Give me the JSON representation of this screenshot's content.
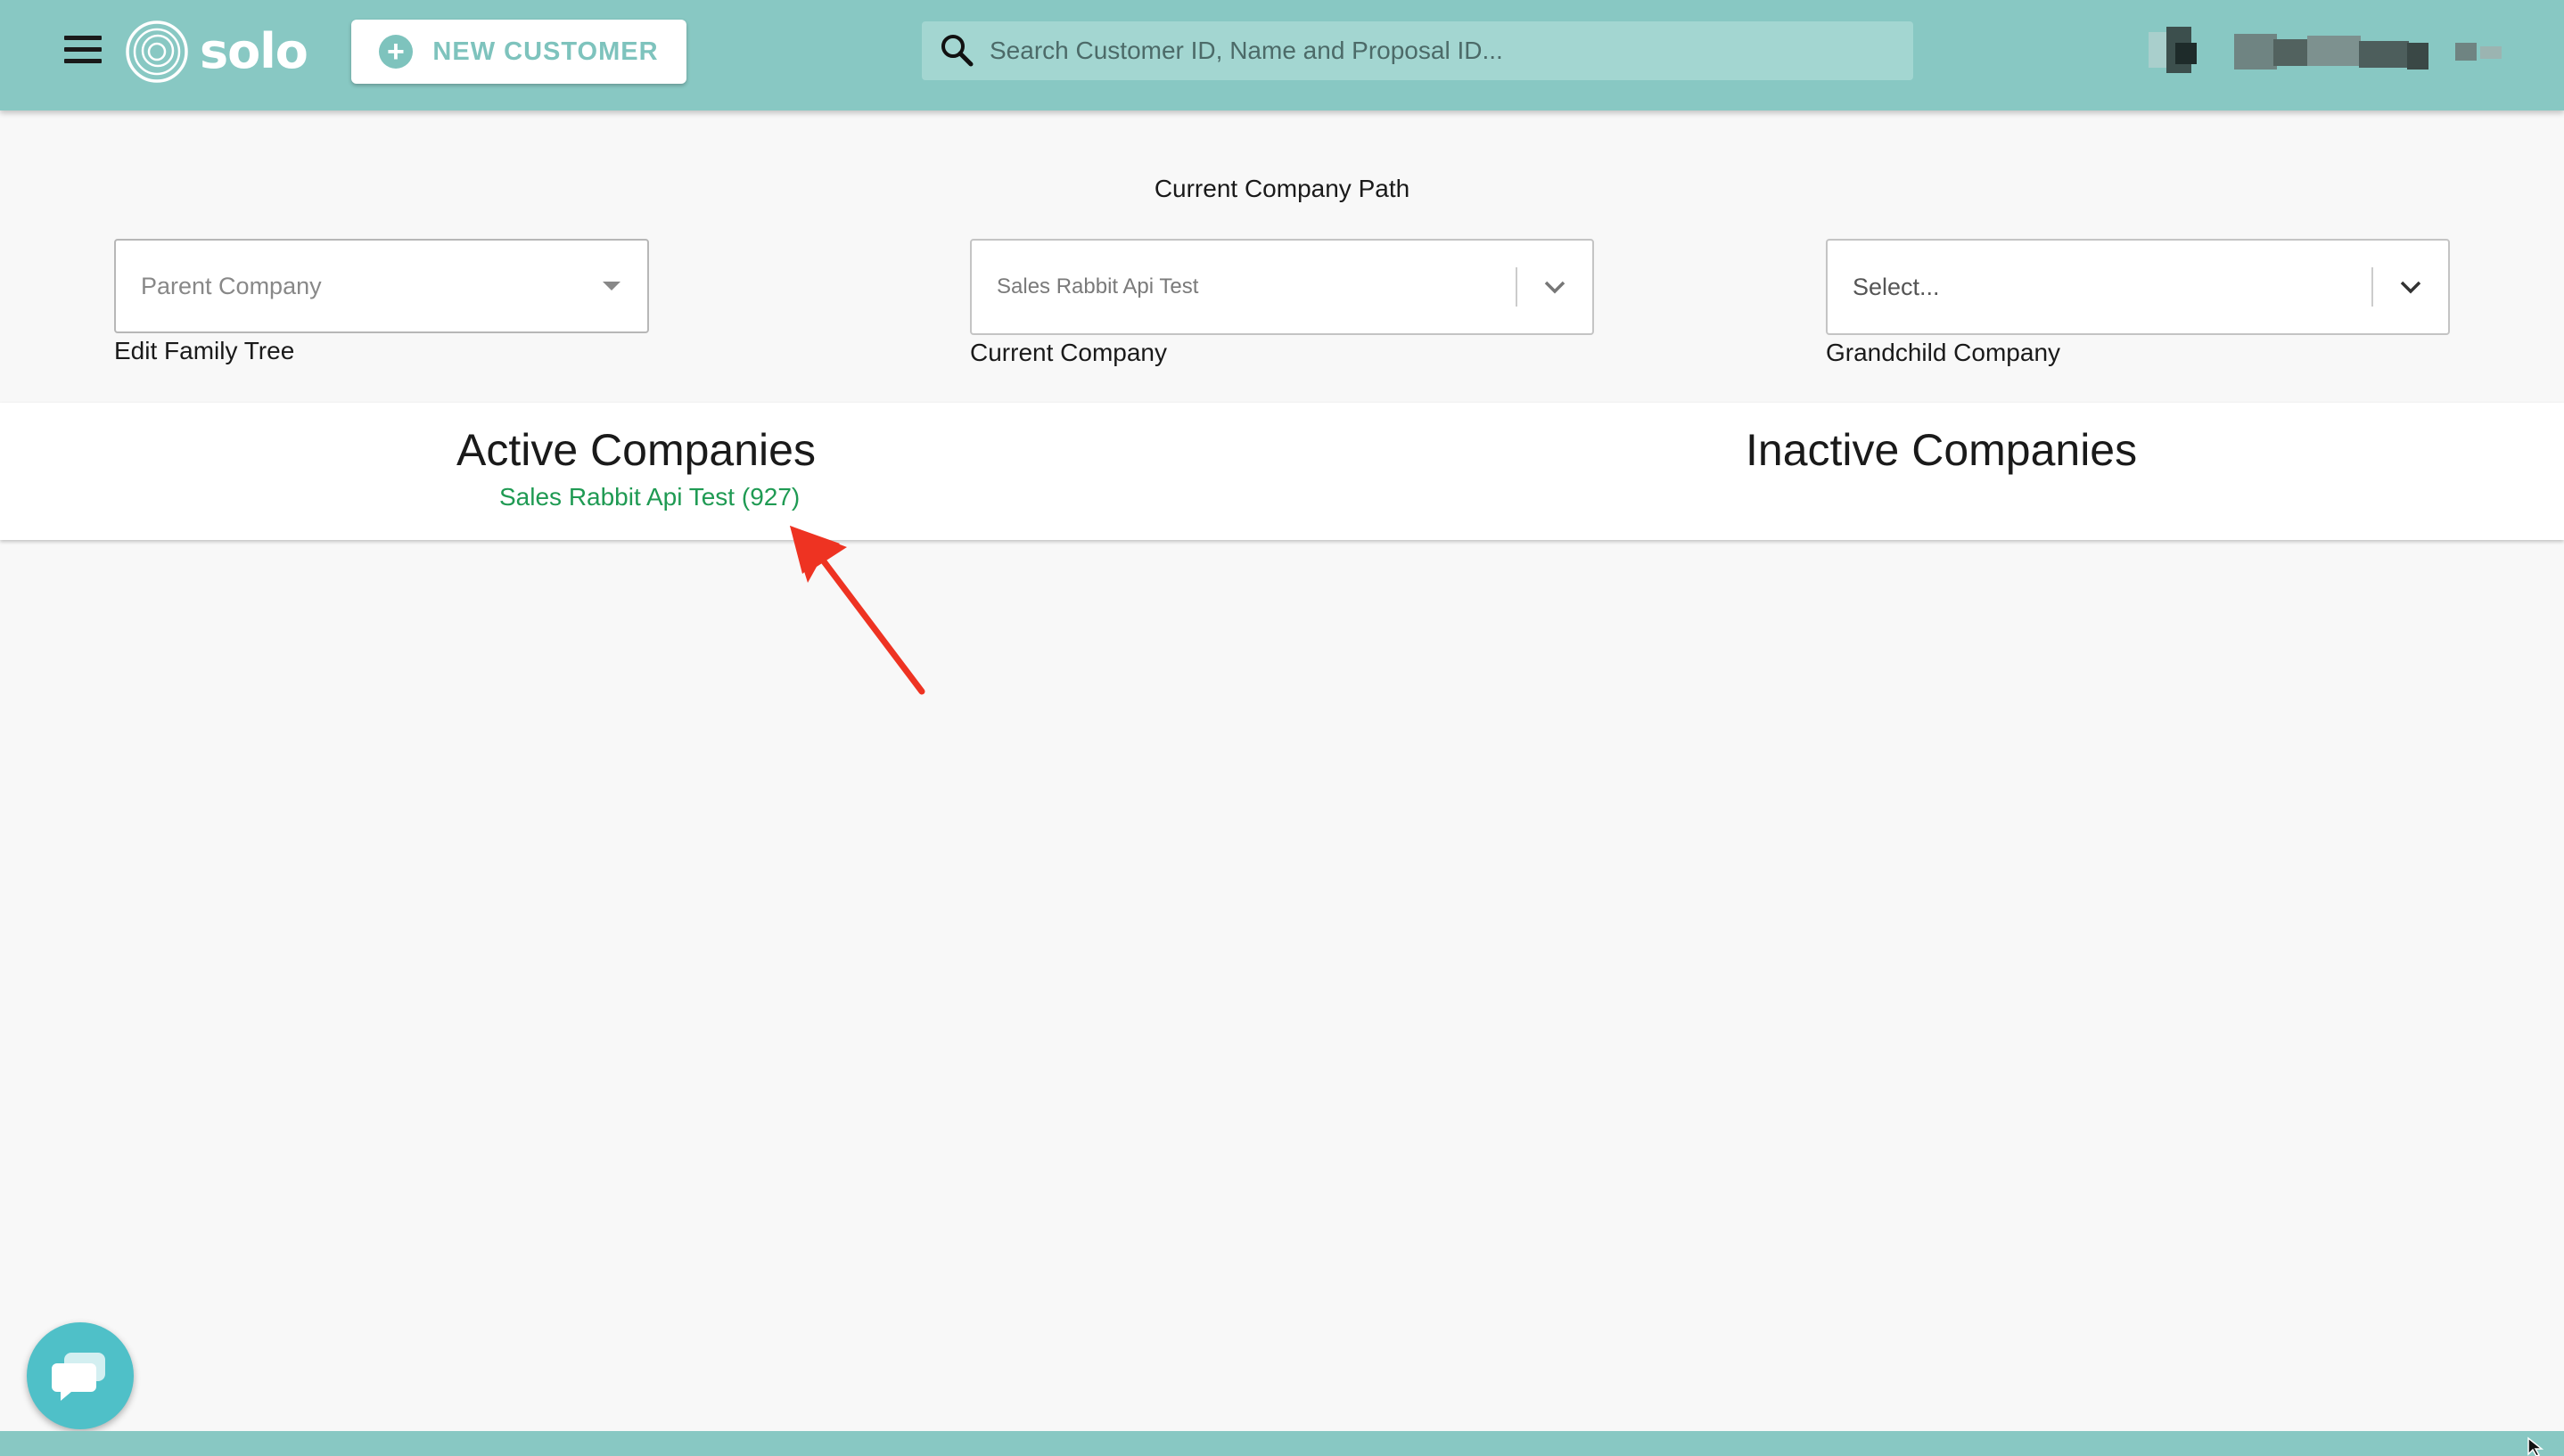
{
  "header": {
    "logo_text": "solo",
    "new_customer_label": "NEW CUSTOMER",
    "search_placeholder": "Search Customer ID, Name and Proposal ID...",
    "colors": {
      "bar": "#88c8c3",
      "accent": "#7ec3bd"
    }
  },
  "company_path": {
    "title": "Current Company Path",
    "parent": {
      "placeholder": "Parent Company",
      "label": "Edit Family Tree"
    },
    "current": {
      "value": "Sales Rabbit Api Test",
      "label": "Current Company"
    },
    "grandchild": {
      "value": "Select...",
      "label": "Grandchild Company"
    }
  },
  "companies": {
    "active_heading": "Active Companies",
    "inactive_heading": "Inactive Companies",
    "active_items": [
      {
        "label": "Sales Rabbit Api Test (927)",
        "color": "#1f9a53"
      }
    ]
  },
  "annotation": {
    "type": "arrow-icon",
    "color": "#ee3322"
  },
  "chat": {
    "icon": "chat-bubble-icon",
    "color": "#4fc0c8"
  }
}
